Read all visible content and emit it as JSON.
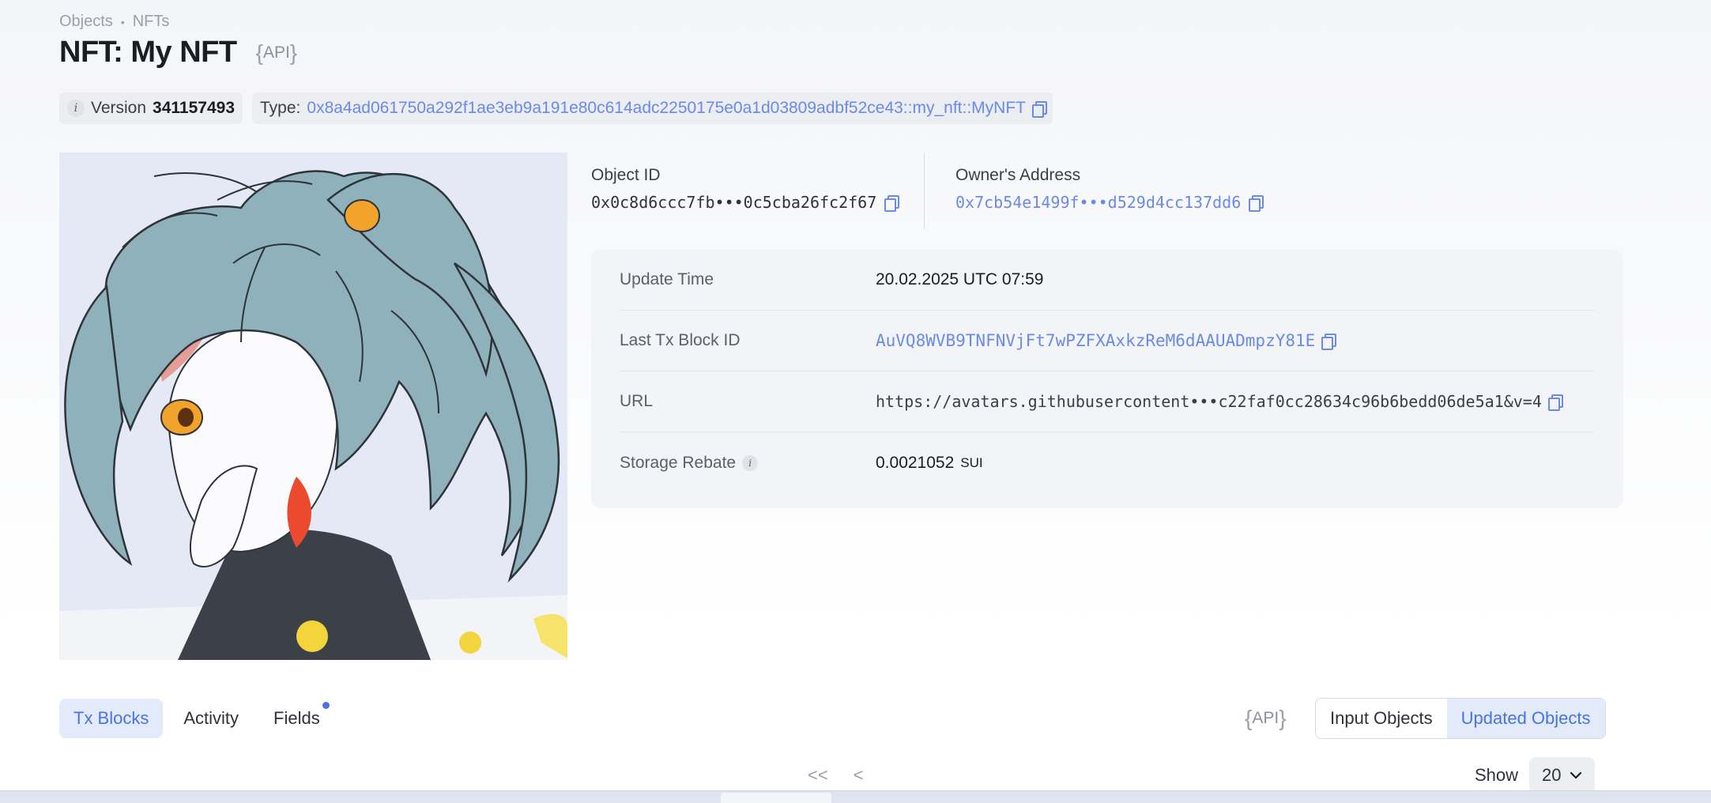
{
  "breadcrumb": {
    "items": [
      "Objects",
      "NFTs"
    ],
    "separator": "•"
  },
  "header": {
    "title": "NFT: My NFT",
    "api_label": "API"
  },
  "chips": {
    "version_label": "Version",
    "version_value": "341157493",
    "type_label": "Type:",
    "type_value": "0x8a4ad061750a292f1ae3eb9a191e80c614adc2250175e0a1d03809adbf52ce43::my_nft::MyNFT"
  },
  "object": {
    "id_label": "Object ID",
    "id_value": "0x0c8d6ccc7fb•••0c5cba26fc2f67",
    "owner_label": "Owner's Address",
    "owner_value": "0x7cb54e1499f•••d529d4cc137dd6"
  },
  "details": {
    "update_time_label": "Update Time",
    "update_time_value": "20.02.2025 UTC 07:59",
    "last_tx_label": "Last Tx Block ID",
    "last_tx_value": "AuVQ8WVB9TNFNVjFt7wPZFXAxkzReM6dAAUADmpzY81E",
    "url_label": "URL",
    "url_value": "https://avatars.githubusercontent•••c22faf0cc28634c96b6bedd06de5a1&v=4",
    "rebate_label": "Storage Rebate",
    "rebate_value": "0.0021052",
    "rebate_unit": "SUI"
  },
  "tabs": [
    {
      "label": "Tx Blocks",
      "active": true
    },
    {
      "label": "Activity",
      "active": false
    },
    {
      "label": "Fields",
      "active": false,
      "has_notification": true
    }
  ],
  "filters": {
    "api_label": "API",
    "input_objects": "Input Objects",
    "updated_objects": "Updated Objects",
    "active": "Updated Objects"
  },
  "pagination": {
    "first": "<<",
    "prev": "<",
    "show_label": "Show",
    "page_size": "20"
  },
  "colors": {
    "accent": "#4b73e0",
    "link": "#6a8ae6",
    "hair": "#8fb1bb"
  }
}
